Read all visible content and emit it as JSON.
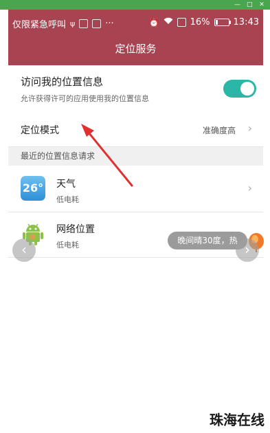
{
  "status_bar": {
    "left_text": "仅限紧急呼叫",
    "more": "···",
    "battery": "16%",
    "battery_level": 0.16,
    "time": "13:43"
  },
  "title": "定位服务",
  "access": {
    "title": "访问我的位置信息",
    "desc": "允许获得许可的应用使用我的位置信息",
    "enabled": true
  },
  "mode": {
    "label": "定位模式",
    "value": "准确度高"
  },
  "recent_header": "最近的位置信息请求",
  "apps": [
    {
      "name": "天气",
      "sub": "低电耗",
      "icon_text": "26°"
    },
    {
      "name": "网络位置",
      "sub": "低电耗"
    }
  ],
  "toast": "晚间晴30度，热",
  "watermark": "珠海在线",
  "colors": {
    "header": "#a84452",
    "toggle": "#2bb6a6",
    "arrow": "#e03030"
  }
}
